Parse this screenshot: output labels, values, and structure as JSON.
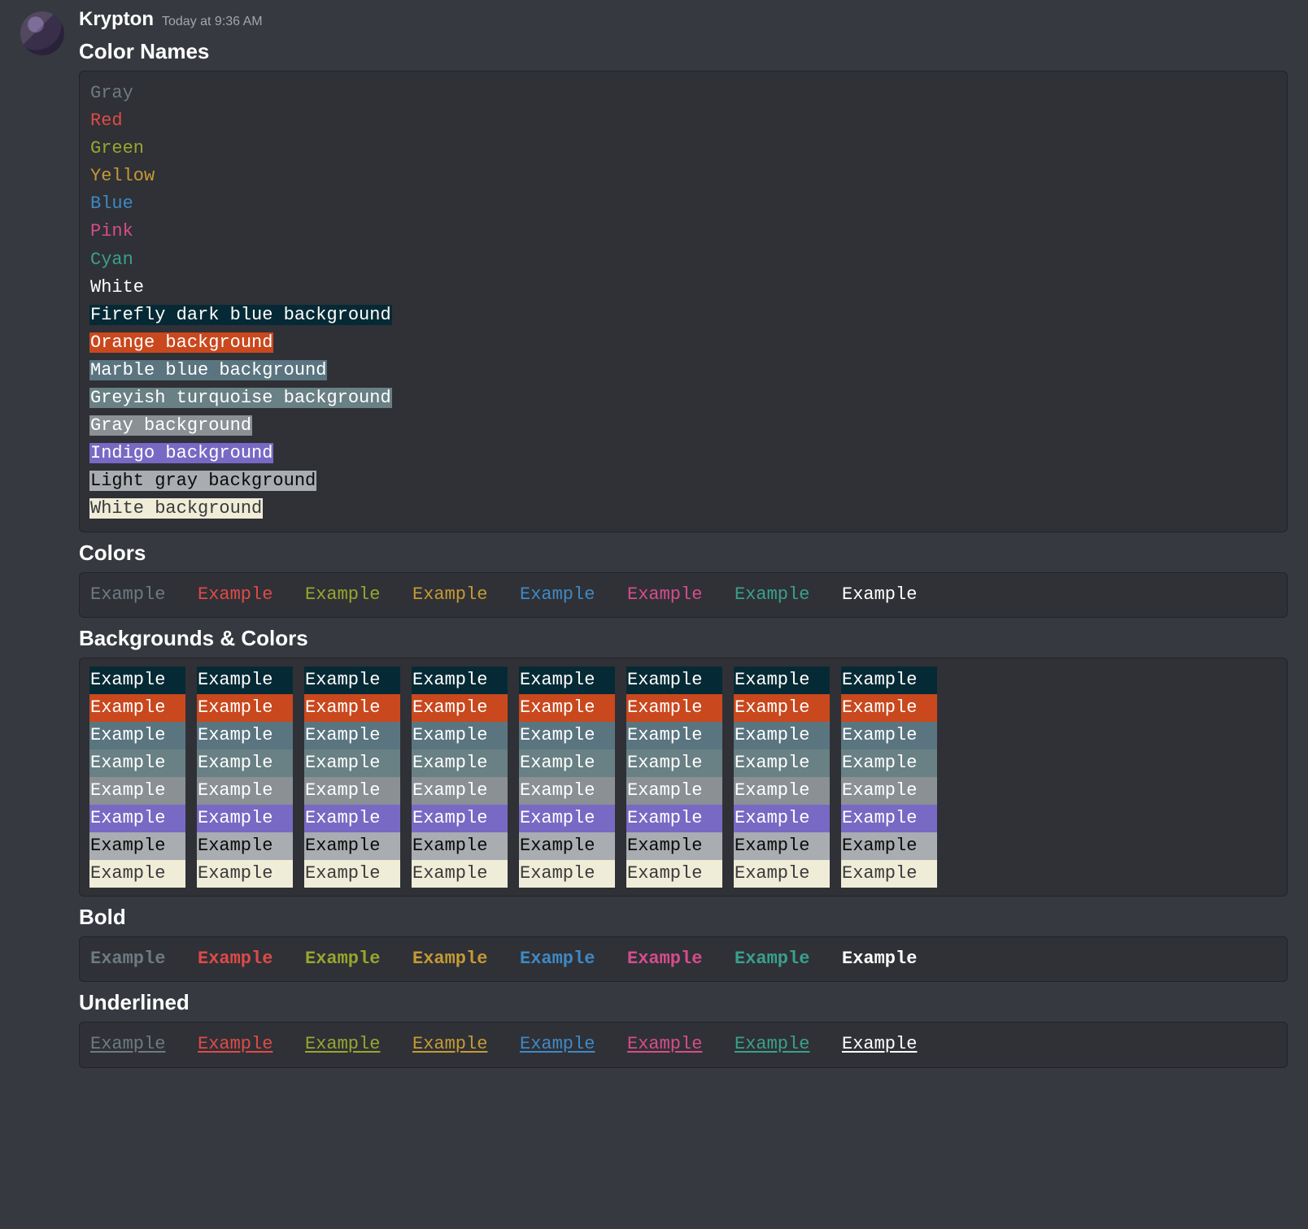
{
  "author": "Krypton",
  "timestamp": "Today at 9:36 AM",
  "sections": {
    "color_names": "Color Names",
    "colors": "Colors",
    "bg_colors": "Backgrounds & Colors",
    "bold": "Bold",
    "underlined": "Underlined"
  },
  "palette": {
    "fg": [
      "#6d7a82",
      "#df4a49",
      "#98a62e",
      "#c59a35",
      "#3f89c5",
      "#d74c8c",
      "#3aa08d",
      "#ffffff"
    ],
    "bg": [
      "#062a35",
      "#c9481d",
      "#5a7580",
      "#698084",
      "#8a9094",
      "#7869c4",
      "#a9acb0",
      "#efecd8"
    ]
  },
  "color_names_fg": [
    "Gray",
    "Red",
    "Green",
    "Yellow",
    "Blue",
    "Pink",
    "Cyan",
    "White"
  ],
  "color_names_bg": [
    "Firefly dark blue background",
    "Orange background",
    "Marble blue background",
    "Greyish turquoise background",
    "Gray background",
    "Indigo background",
    "Light gray background",
    "White background"
  ],
  "example_word": "Example"
}
